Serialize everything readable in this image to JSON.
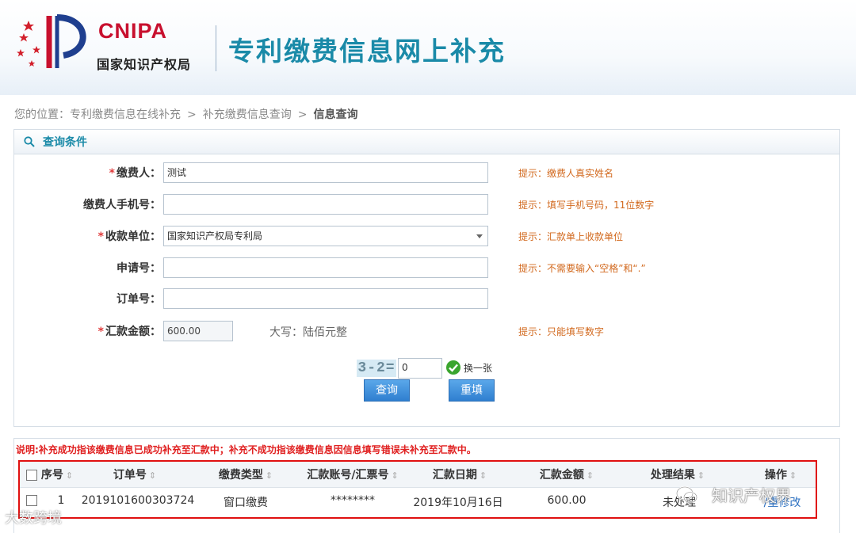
{
  "header": {
    "logo_en": "CNIPA",
    "logo_cn": "国家知识产权局",
    "title": "专利缴费信息网上补充"
  },
  "breadcrumb": {
    "prefix": "您的位置：",
    "items": [
      "专利缴费信息在线补充",
      "补充缴费信息查询",
      "信息查询"
    ],
    "separator": ">"
  },
  "query_panel": {
    "title": "查询条件",
    "fields": {
      "payer": {
        "label": "缴费人：",
        "required": "*",
        "value": "测试",
        "hint": "提示：缴费人真实姓名"
      },
      "phone": {
        "label": "缴费人手机号：",
        "value": "",
        "hint": "提示：填写手机号码，11位数字"
      },
      "payee": {
        "label": "收款单位：",
        "required": "*",
        "value": "国家知识产权局专利局",
        "hint": "提示：汇款单上收款单位"
      },
      "application_no": {
        "label": "申请号：",
        "value": "",
        "hint": "提示：不需要输入“空格”和“.”"
      },
      "order_no": {
        "label": "订单号：",
        "value": ""
      },
      "amount": {
        "label": "汇款金额：",
        "required": "*",
        "value": "600.00",
        "capital": "大写：陆佰元整",
        "hint": "提示：只能填写数字"
      }
    },
    "captcha": {
      "image_text": "3-2=",
      "input_value": "0",
      "refresh_label": "换一张"
    },
    "buttons": {
      "query": "查询",
      "reset": "重填"
    }
  },
  "results": {
    "note": "说明:补充成功指该缴费信息已成功补充至汇款中；补充不成功指该缴费信息因信息填写错误未补充至汇款中。",
    "columns": [
      "序号",
      "订单号",
      "缴费类型",
      "汇款账号/汇票号",
      "汇款日期",
      "汇款金额",
      "处理结果",
      "操作"
    ],
    "sort_glyph": "⇕",
    "rows": [
      [
        "1",
        "2019101600303724",
        "窗口缴费",
        "********",
        "2019年10月16日",
        "600.00",
        "未处理",
        "/重修改"
      ]
    ]
  },
  "watermarks": {
    "wechat": "知识产权界",
    "bottom_left": "大数跨境"
  },
  "colors": {
    "title_teal": "#1a8aa8",
    "hint_orange": "#d2691e",
    "note_red": "#e02020",
    "logo_red": "#c8102e",
    "button_blue": "#2f7fd0"
  }
}
